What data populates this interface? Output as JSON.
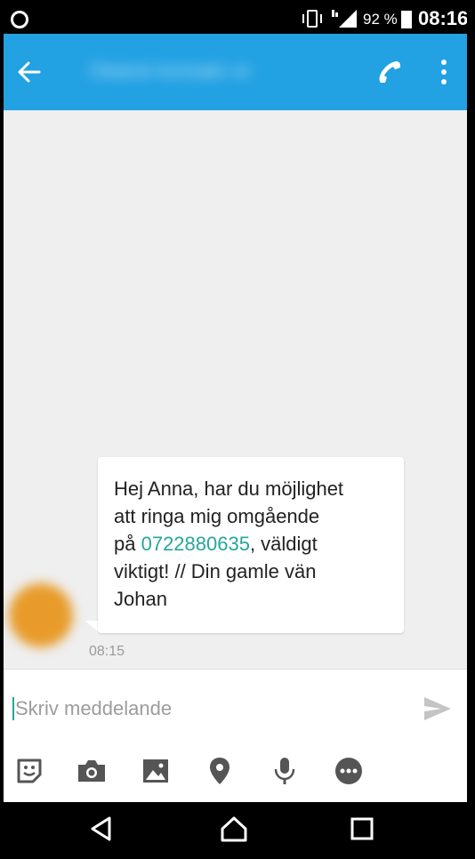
{
  "status_bar": {
    "battery_percent": "92 %",
    "time": "08:16",
    "icons": [
      "notification-ring-icon",
      "vibrate-icon",
      "signal-icon",
      "battery-icon"
    ]
  },
  "app_bar": {
    "contact_name": "Okänd kontakt nr",
    "icons": [
      "back-arrow-icon",
      "phone-icon",
      "more-vert-icon"
    ],
    "color": "#22a1e3"
  },
  "message": {
    "lines": [
      "Hej Anna, har du möjlighet",
      "att ringa mig omgående"
    ],
    "line3_prefix": "på ",
    "phone_number": "0722880635",
    "line3_suffix": ", väldigt",
    "line4": "viktigt! // Din gamle vän",
    "line5": "Johan",
    "time": "08:15",
    "link_color": "#26a69a"
  },
  "composer": {
    "placeholder": "Skriv meddelande",
    "tools": [
      "sticker-icon",
      "camera-icon",
      "gallery-icon",
      "location-icon",
      "microphone-icon",
      "more-options-icon"
    ],
    "send_icon": "send-icon"
  },
  "nav_bar": {
    "icons": [
      "back-triangle-icon",
      "home-icon",
      "recents-icon"
    ]
  }
}
